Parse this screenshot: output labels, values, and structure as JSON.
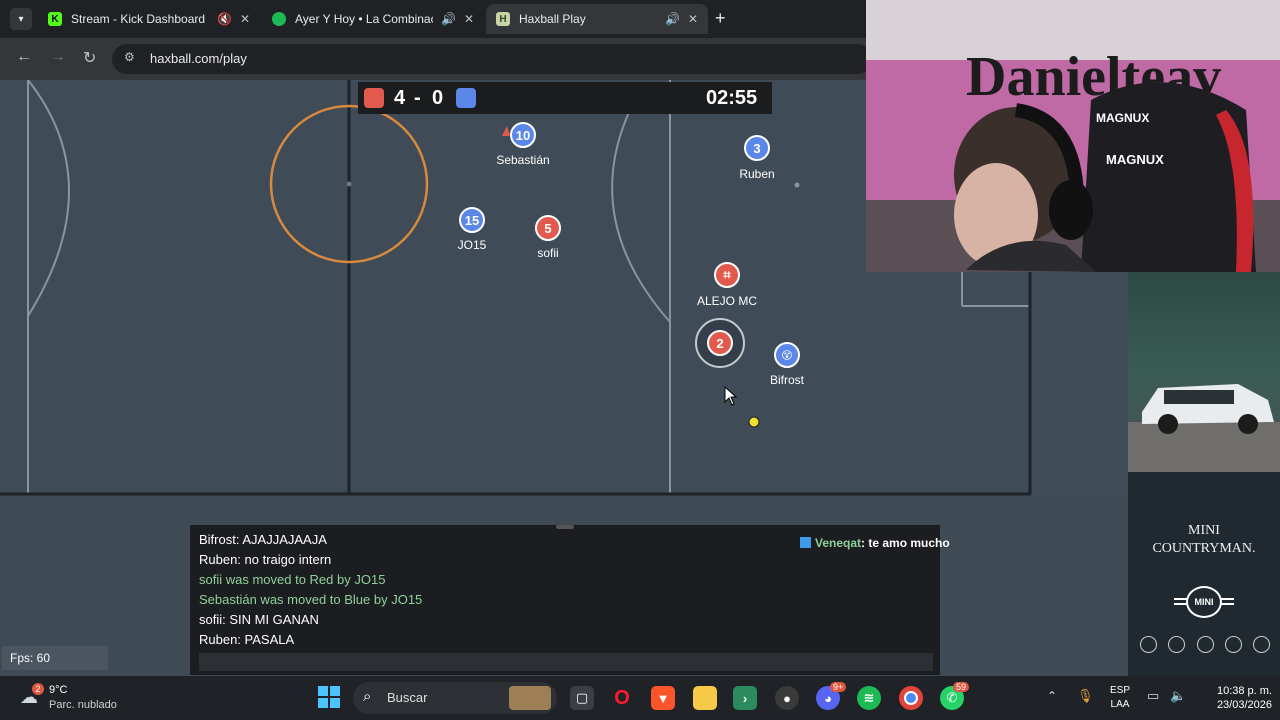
{
  "browser": {
    "tabs": [
      {
        "title": "Stream - Kick Dashboard"
      },
      {
        "title": "Ayer Y Hoy • La Combinación"
      },
      {
        "title": "Haxball Play"
      }
    ],
    "new_tab_symbol": "+",
    "url": "haxball.com/play"
  },
  "game": {
    "score": {
      "red": "4",
      "separator": "-",
      "blue": "0"
    },
    "timer": "02:55",
    "players": [
      {
        "number": "10",
        "name": "Sebastián",
        "team": "blue"
      },
      {
        "number": "3",
        "name": "Ruben",
        "team": "blue"
      },
      {
        "number": "15",
        "name": "JO15",
        "team": "blue"
      },
      {
        "number": "5",
        "name": "sofii",
        "team": "red"
      },
      {
        "number": "⌗",
        "name": "ALEJO MC",
        "team": "red"
      },
      {
        "number": "2",
        "name": "",
        "team": "red"
      },
      {
        "number": "😵",
        "name": "Bifrost",
        "team": "blue"
      }
    ],
    "fps": "Fps: 60"
  },
  "chat": {
    "messages": [
      {
        "text": "Bifrost: AJAJJAJAAJA",
        "type": "message"
      },
      {
        "text": "Ruben: no traigo intern",
        "type": "message"
      },
      {
        "text": "sofii was moved to Red by JO15",
        "type": "notice"
      },
      {
        "text": "Sebastián was moved to Blue by JO15",
        "type": "notice"
      },
      {
        "text": "sofii: SIN MI GANAN",
        "type": "message"
      },
      {
        "text": "Ruben: PASALA",
        "type": "message"
      }
    ],
    "input_value": ""
  },
  "stream_chat": {
    "user": "Veneqat",
    "message": ": te amo mucho"
  },
  "webcam": {
    "graffiti_text": "Danielteav",
    "chair_brand": "MAGNUX"
  },
  "ad": {
    "line1": "MINI",
    "line2": "COUNTRYMAN.",
    "logo": "MINI"
  },
  "taskbar": {
    "weather": {
      "temp": "9°C",
      "condition": "Parc. nublado",
      "badge": "2"
    },
    "search_placeholder": "Buscar",
    "lang": {
      "line1": "ESP",
      "line2": "LAA"
    },
    "time": "10:38 p. m.",
    "date": "23/03/2026",
    "whatsapp_badge": "59",
    "discord_badge": "9+"
  },
  "colors": {
    "red_team": "#e25a4d",
    "blue_team": "#5b87e8",
    "notice_text": "#8fd19a",
    "accent_orange": "#d8893e"
  }
}
